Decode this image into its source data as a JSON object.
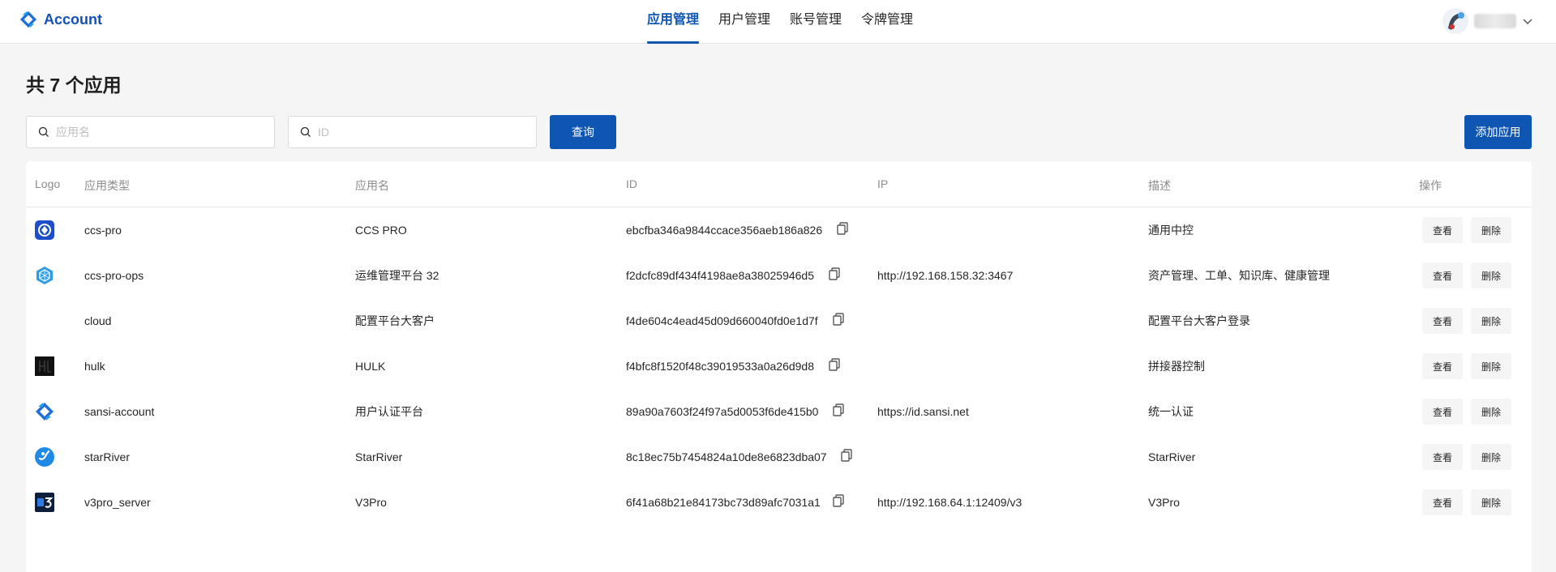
{
  "app": {
    "name": "Account"
  },
  "nav": {
    "items": [
      {
        "label": "应用管理",
        "active": true
      },
      {
        "label": "用户管理",
        "active": false
      },
      {
        "label": "账号管理",
        "active": false
      },
      {
        "label": "令牌管理",
        "active": false
      }
    ]
  },
  "user": {
    "name": "xxxxxxx",
    "avatar_icon": "avatar-icon"
  },
  "header": {
    "title": "共 7 个应用",
    "name_search_placeholder": "应用名",
    "id_search_placeholder": "ID",
    "query_label": "查询",
    "add_label": "添加应用"
  },
  "table": {
    "columns": {
      "logo": "Logo",
      "type": "应用类型",
      "name": "应用名",
      "id": "ID",
      "ip": "IP",
      "desc": "描述",
      "actions": "操作"
    },
    "view_label": "查看",
    "delete_label": "删除",
    "rows": [
      {
        "logo": "ccs-pro-logo",
        "type": "ccs-pro",
        "name": "CCS PRO",
        "id": "ebcfba346a9844ccace356aeb186a826",
        "ip": "",
        "desc": "通用中控"
      },
      {
        "logo": "ccs-pro-ops-logo",
        "type": "ccs-pro-ops",
        "name": "运维管理平台 32",
        "id": "f2dcfc89df434f4198ae8a38025946d5",
        "ip": "http://192.168.158.32:3467",
        "desc": "资产管理、工单、知识库、健康管理"
      },
      {
        "logo": "",
        "type": "cloud",
        "name": "配置平台大客户",
        "id": "f4de604c4ead45d09d660040fd0e1d7f",
        "ip": "",
        "desc": "配置平台大客户登录"
      },
      {
        "logo": "hulk-logo",
        "type": "hulk",
        "name": "HULK",
        "id": "f4bfc8f1520f48c39019533a0a26d9d8",
        "ip": "",
        "desc": "拼接器控制"
      },
      {
        "logo": "sansi-account-logo",
        "type": "sansi-account",
        "name": "用户认证平台",
        "id": "89a90a7603f24f97a5d0053f6de415b0",
        "ip": "https://id.sansi.net",
        "desc": "统一认证"
      },
      {
        "logo": "starriver-logo",
        "type": "starRiver",
        "name": "StarRiver",
        "id": "8c18ec75b7454824a10de8e6823dba07",
        "ip": "",
        "desc": "StarRiver"
      },
      {
        "logo": "v3pro-logo",
        "type": "v3pro_server",
        "name": "V3Pro",
        "id": "6f41a68b21e84173bc73d89afc7031a1",
        "ip": "http://192.168.64.1:12409/v3",
        "desc": "V3Pro"
      }
    ]
  },
  "colors": {
    "primary": "#0f56b3",
    "background": "#f5f5f5"
  }
}
